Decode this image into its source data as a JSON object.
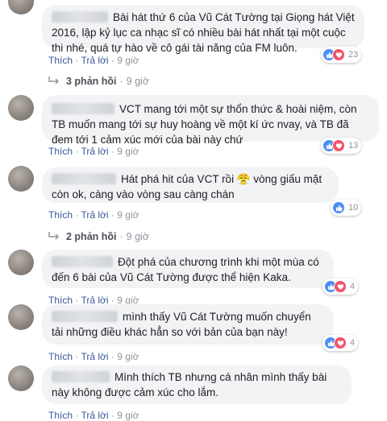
{
  "actions": {
    "like": "Thích",
    "reply": "Trả lời",
    "dot": "·"
  },
  "comments": [
    {
      "text": "Bài hát thứ 6 của Vũ Cát Tường tại Giọng hát Việt 2016, lập kỷ lục ca nhạc sĩ có nhiều bài hát nhất tại một cuộc thi nhé, quá tự hào về cô gái tài năng của FM luôn.",
      "time": "9 giờ",
      "reactions": [
        "like",
        "love"
      ],
      "count": "23"
    },
    {
      "text": "VCT mang tới một sự thổn thức & hoài niệm, còn TB muốn mang tới sự huy hoàng về một kí ức nvay, và TB đã đem tới 1 cảm xúc mới của bài này chứ",
      "time": "9 giờ",
      "reactions": [
        "like",
        "love"
      ],
      "count": "13"
    },
    {
      "text": "Hát phá hit của VCT rồi 😤 vòng giấu mặt còn ok, càng vào vòng sau càng chán",
      "time": "9 giờ",
      "reactions": [
        "like"
      ],
      "count": "10"
    },
    {
      "text": "Đột phá của chương trình khi một mùa có đến 6 bài của Vũ Cát Tường được thể hiện Kaka.",
      "time": "9 giờ",
      "reactions": [
        "like",
        "love"
      ],
      "count": "4"
    },
    {
      "text": "mình thấy Vũ Cát Tường muốn chuyển tải những điều khác hẳn so với bản của bạn này!",
      "time": "9 giờ",
      "reactions": [
        "like",
        "love"
      ],
      "count": "4"
    },
    {
      "text": "Mình thích TB nhưng cá nhân mình thấy bài này không được cảm xúc cho lắm.",
      "time": "9 giờ",
      "reactions": [],
      "count": ""
    }
  ],
  "reply_threads": [
    {
      "label": "3 phản hồi",
      "time": "9 giờ"
    },
    {
      "label": "2 phản hồi",
      "time": "9 giờ"
    }
  ],
  "colors": {
    "link": "#385898",
    "like": "#4c8ff3",
    "love": "#f25268",
    "bubble": "#f2f3f5"
  }
}
